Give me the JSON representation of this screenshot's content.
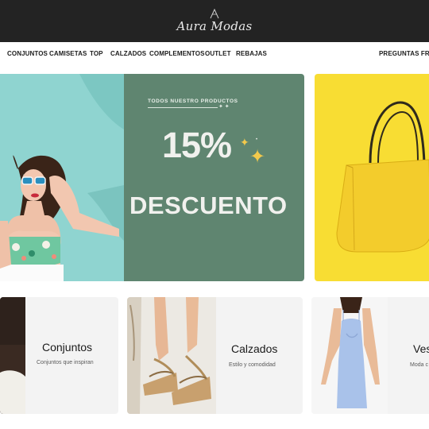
{
  "header": {
    "logo_text": "Aura Modas",
    "background": "#232323"
  },
  "nav": {
    "items": [
      {
        "label": "CONJUNTOS"
      },
      {
        "label": "CAMISETAS"
      },
      {
        "label": "TOP"
      },
      {
        "label": "CALZADOS"
      },
      {
        "label": "COMPLEMENTOS"
      },
      {
        "label": "OUTLET"
      },
      {
        "label": "REBAJAS"
      },
      {
        "label": "PREGUNTAS FRECU"
      }
    ]
  },
  "hero": {
    "kicker": "TODOS NUESTRO PRODUCTOS",
    "discount": "15%",
    "headline": "DESCUENTO",
    "background": "#5f8570",
    "photo_background": "#8fd4d0"
  },
  "side_banner": {
    "background": "#f8dd33",
    "product_icon": "yellow-handbag"
  },
  "categories": [
    {
      "title": "Conjuntos",
      "subtitle": "Conjuntos que inspiran"
    },
    {
      "title": "Calzados",
      "subtitle": "Estilo y comodidad"
    },
    {
      "title": "Ves",
      "subtitle": "Moda c"
    }
  ]
}
